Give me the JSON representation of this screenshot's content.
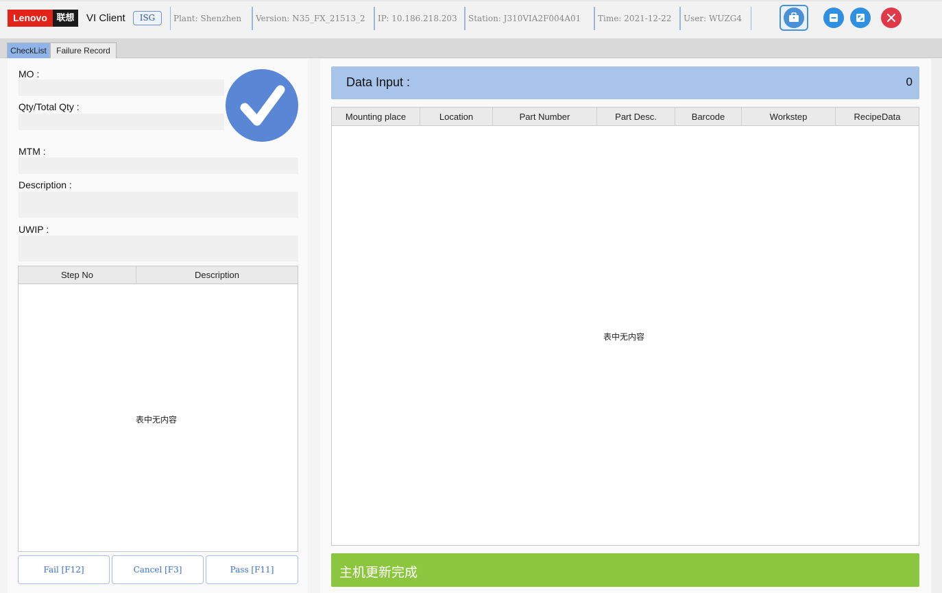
{
  "header": {
    "logo_en": "Lenovo",
    "logo_cn": "联想",
    "app_title": "VI Client",
    "badge": "ISG",
    "plant": "Plant: Shenzhen",
    "version": "Version: N35_FX_21513_2",
    "ip": "IP: 10.186.218.203",
    "station": "Station: J310VIA2F004A01",
    "time": "Time: 2021-12-22",
    "user": "User: WUZG4",
    "buttons": [
      "briefcase-icon",
      "minimize-icon",
      "maximize-icon",
      "close-icon"
    ]
  },
  "tabs": [
    {
      "label": "CheckList",
      "active": true
    },
    {
      "label": "Failure Record",
      "active": false
    }
  ],
  "left": {
    "mo_label": "MO :",
    "qty_label": "Qty/Total Qty :",
    "mtm_label": "MTM :",
    "description_label": "Description :",
    "uwip_label": "UWIP :",
    "step_table": {
      "columns": [
        "Step No",
        "Description"
      ],
      "empty_text": "表中无内容"
    },
    "buttons": {
      "fail": "Fail [F12]",
      "cancel": "Cancel [F3]",
      "pass": "Pass [F11]"
    }
  },
  "right": {
    "title": "Data Input :",
    "count": "0",
    "columns": [
      "Mounting place",
      "Location",
      "Part Number",
      "Part Desc.",
      "Barcode",
      "Workstep",
      "RecipeData"
    ],
    "empty_text": "表中无内容",
    "status": "主机更新完成"
  },
  "colors": {
    "accent_blue": "#5a86d6",
    "header_blue": "#a8c4ea",
    "status_green": "#8cc63f",
    "close_red": "#e0394a",
    "lenovo_red": "#e2231a"
  }
}
